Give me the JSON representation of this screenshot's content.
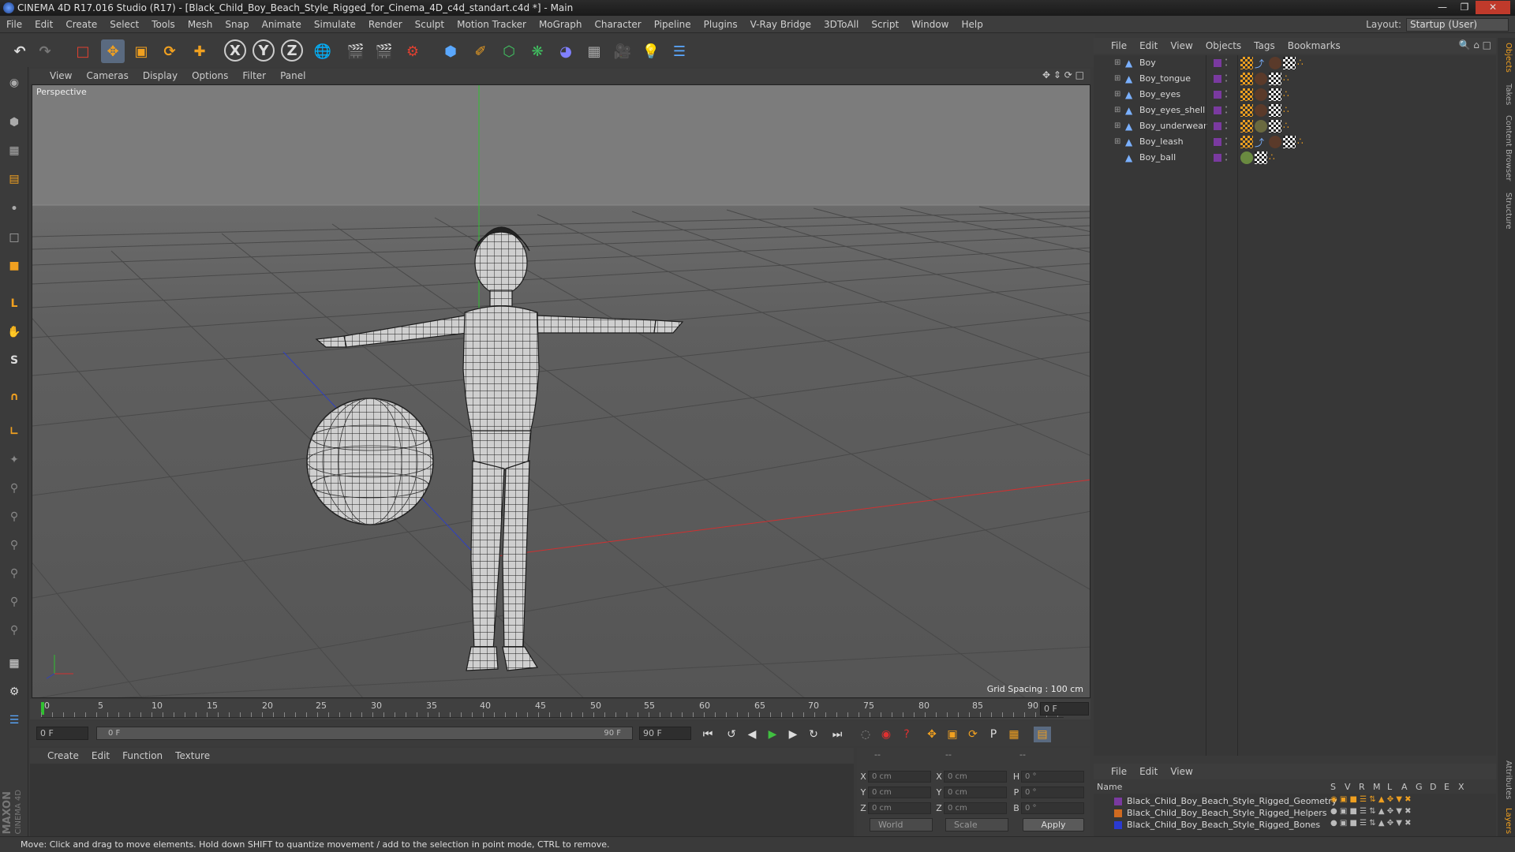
{
  "window": {
    "title": "CINEMA 4D R17.016 Studio (R17) - [Black_Child_Boy_Beach_Style_Rigged_for_Cinema_4D_c4d_standart.c4d *] - Main"
  },
  "menubar": {
    "items": [
      "File",
      "Edit",
      "Create",
      "Select",
      "Tools",
      "Mesh",
      "Snap",
      "Animate",
      "Simulate",
      "Render",
      "Sculpt",
      "Motion Tracker",
      "MoGraph",
      "Character",
      "Pipeline",
      "Plugins",
      "V-Ray Bridge",
      "3DToAll",
      "Script",
      "Window",
      "Help"
    ],
    "layout_label": "Layout:",
    "layout_value": "Startup (User)"
  },
  "viewport": {
    "menu": [
      "View",
      "Cameras",
      "Display",
      "Options",
      "Filter",
      "Panel"
    ],
    "camera_label": "Perspective",
    "grid_spacing": "Grid Spacing : 100 cm"
  },
  "timeline": {
    "ticks": [
      "0",
      "5",
      "10",
      "15",
      "20",
      "25",
      "30",
      "35",
      "40",
      "45",
      "50",
      "55",
      "60",
      "65",
      "70",
      "75",
      "80",
      "85",
      "90"
    ],
    "current_frame_field": "0 F",
    "start_field": "0 F",
    "range_start": "0 F",
    "range_end": "90 F",
    "end_field": "90 F"
  },
  "material_panel": {
    "menu": [
      "Create",
      "Edit",
      "Function",
      "Texture"
    ]
  },
  "coordinates": {
    "header_left": "--",
    "header_mid": "--",
    "header_right": "--",
    "rows": [
      {
        "l1": "X",
        "v1": "0 cm",
        "l2": "X",
        "v2": "0 cm",
        "l3": "H",
        "v3": "0 °"
      },
      {
        "l1": "Y",
        "v1": "0 cm",
        "l2": "Y",
        "v2": "0 cm",
        "l3": "P",
        "v3": "0 °"
      },
      {
        "l1": "Z",
        "v1": "0 cm",
        "l2": "Z",
        "v2": "0 cm",
        "l3": "B",
        "v3": "0 °"
      }
    ],
    "mode_world": "World",
    "mode_scale": "Scale",
    "apply": "Apply"
  },
  "object_manager": {
    "menu": [
      "File",
      "Edit",
      "View",
      "Objects",
      "Tags",
      "Bookmarks"
    ],
    "objects": [
      {
        "name": "Boy"
      },
      {
        "name": "Boy_tongue"
      },
      {
        "name": "Boy_eyes"
      },
      {
        "name": "Boy_eyes_shell"
      },
      {
        "name": "Boy_underwear"
      },
      {
        "name": "Boy_leash"
      },
      {
        "name": "Boy_ball"
      }
    ]
  },
  "layer_manager": {
    "menu": [
      "File",
      "Edit",
      "View"
    ],
    "columns": [
      "Name",
      "S",
      "V",
      "R",
      "M",
      "L",
      "A",
      "G",
      "D",
      "E",
      "X"
    ],
    "layers": [
      {
        "name": "Black_Child_Boy_Beach_Style_Rigged_Geometry",
        "color": "#7a3aa0"
      },
      {
        "name": "Black_Child_Boy_Beach_Style_Rigged_Helpers",
        "color": "#d06a20"
      },
      {
        "name": "Black_Child_Boy_Beach_Style_Rigged_Bones",
        "color": "#2a3ad0"
      }
    ]
  },
  "right_tabs": [
    "Objects",
    "Takes",
    "Content Browser",
    "Structure",
    "Attributes",
    "Layers"
  ],
  "status": {
    "text": "Move: Click and drag to move elements. Hold down SHIFT to quantize movement / add to the selection in point mode, CTRL to remove."
  },
  "branding": {
    "maxon": "MAXON",
    "c4d": "CINEMA 4D"
  },
  "colors": {
    "accent_orange": "#f0a020",
    "axis_x": "#d03030",
    "axis_y": "#30c030",
    "axis_z": "#3040c0",
    "play_green": "#40c040"
  }
}
